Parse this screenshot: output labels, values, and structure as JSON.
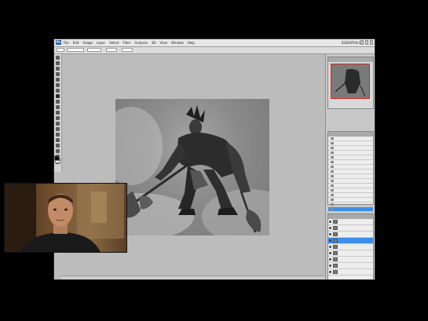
{
  "app": {
    "logo_text": "Ps",
    "menu_items": [
      "File",
      "Edit",
      "Image",
      "Layer",
      "Select",
      "Filter",
      "Analysis",
      "3D",
      "View",
      "Window",
      "Help"
    ],
    "workspace_label": "ESSENTIALS"
  },
  "history": {
    "rows": 16
  },
  "layers": {
    "rows": 9
  },
  "colors": {
    "accent": "#3d8ee8",
    "navigator_frame": "#e02020",
    "canvas_bg": "#bcbcbc"
  }
}
